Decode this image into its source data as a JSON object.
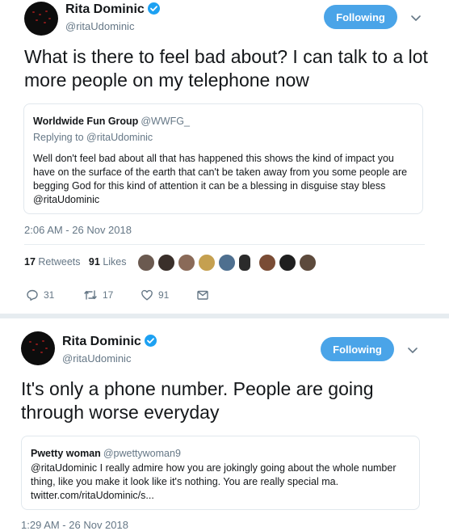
{
  "tweet1": {
    "author_name": "Rita Dominic",
    "author_handle": "@ritaUdominic",
    "follow_label": "Following",
    "text": "What is there to feel bad about? I can talk to a lot more people on my telephone now",
    "quote": {
      "author_name": "Worldwide Fun Group",
      "author_handle": "@WWFG_",
      "replying_prefix": "Replying to",
      "replying_handle": "@ritaUdominic",
      "body": "Well don't feel bad about all that has happened this shows the kind of impact you have on the surface of the earth that can't be taken away from you  some people are begging God for this kind of attention it can be a blessing in disguise stay bless @ritaUdominic"
    },
    "timestamp": "2:06 AM - 26 Nov 2018",
    "retweets_count": "17",
    "retweets_label": "Retweets",
    "likes_count": "91",
    "likes_label": "Likes",
    "actions": {
      "replies": "31",
      "retweets": "17",
      "likes": "91"
    }
  },
  "tweet2": {
    "author_name": "Rita Dominic",
    "author_handle": "@ritaUdominic",
    "follow_label": "Following",
    "text": "It's only a phone number. People are going through worse everyday",
    "quote": {
      "author_name": "Pwetty woman",
      "author_handle": "@pwettywoman9",
      "body": "@ritaUdominic  I really  admire how you are jokingly going about the whole number thing, like you make it look like it's nothing. You are really special ma. twitter.com/ritaUdominic/s..."
    },
    "timestamp": "1:29 AM - 26 Nov 2018"
  },
  "colors": {
    "accent": "#1da1f2",
    "follow_button": "#4aa4e8",
    "secondary_text": "#657786",
    "divider": "#e6ecf0"
  },
  "icons": [
    "verified-badge-icon",
    "chevron-down-icon",
    "reply-icon",
    "retweet-icon",
    "like-icon",
    "direct-message-icon"
  ]
}
